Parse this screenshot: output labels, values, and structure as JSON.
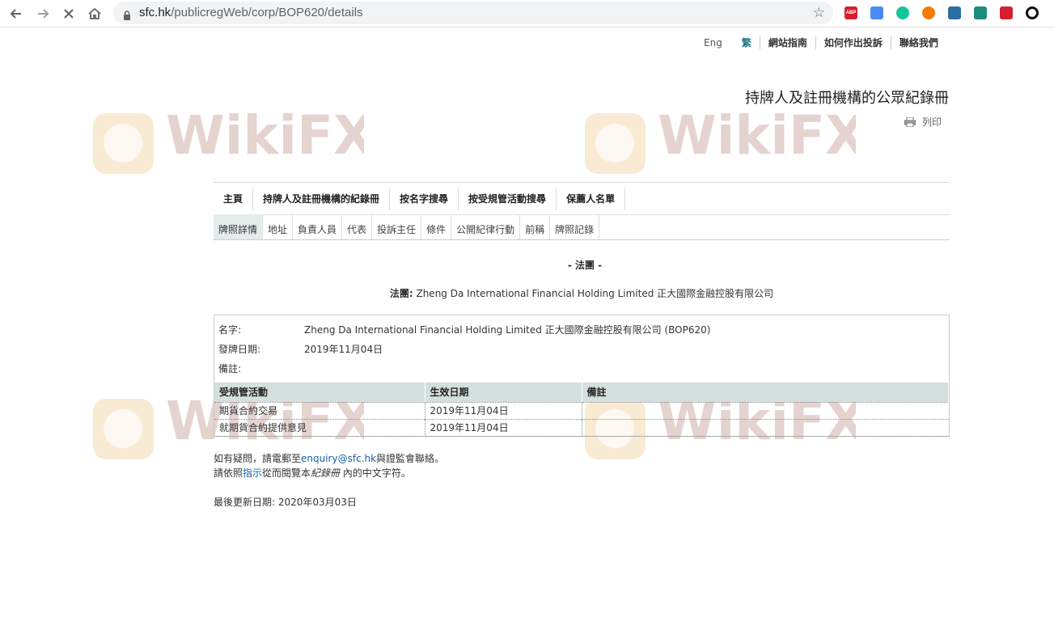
{
  "browser": {
    "url_host": "sfc.hk",
    "url_path": "/publicregWeb/corp/BOP620/details",
    "extensions": [
      {
        "name": "adblock-plus-icon",
        "label": "ABP",
        "color": "#d6202f"
      },
      {
        "name": "translate-icon",
        "label": "",
        "color": "#4a8af4"
      },
      {
        "name": "grammarly-icon",
        "label": "",
        "color": "#15c39a"
      },
      {
        "name": "extension-infinity-icon",
        "label": "",
        "color": "#f57c00"
      },
      {
        "name": "extension-s-icon",
        "label": "",
        "color": "#2e6da4"
      },
      {
        "name": "extension-check-icon",
        "label": "",
        "color": "#1e8c7a"
      },
      {
        "name": "extension-shield-icon",
        "label": "",
        "color": "#d6202f"
      },
      {
        "name": "extension-circle-icon",
        "label": "",
        "color": "#111111"
      }
    ]
  },
  "toplinks": {
    "eng": "Eng",
    "trad": "繁",
    "guide": "網站指南",
    "complaint": "如何作出投訴",
    "contact": "聯絡我們"
  },
  "page_title": "持牌人及註冊機構的公眾紀錄冊",
  "print_label": "列印",
  "main_nav": [
    "主頁",
    "持牌人及註冊機構的紀錄冊",
    "按名字搜尋",
    "按受規管活動搜尋",
    "保薦人名單"
  ],
  "sub_tabs": [
    "牌照詳情",
    "地址",
    "負責人員",
    "代表",
    "投訴主任",
    "條件",
    "公開紀律行動",
    "前稱",
    "牌照記錄"
  ],
  "section_title": "- 法團 -",
  "corp_label": "法團:",
  "corp_name": "Zheng Da International Financial Holding Limited 正大國際金融控股有限公司",
  "details": {
    "name_label": "名字:",
    "name_value": "Zheng Da International Financial Holding Limited 正大國際金融控股有限公司 (BOP620)",
    "issue_label": "發牌日期:",
    "issue_value": "2019年11月04日",
    "remark_label": "備註:",
    "remark_value": ""
  },
  "activities": {
    "headers": [
      "受規管活動",
      "生效日期",
      "備註"
    ],
    "rows": [
      [
        "期貨合約交易",
        "2019年11月04日",
        ""
      ],
      [
        "就期貨合約提供意見",
        "2019年11月04日",
        ""
      ]
    ]
  },
  "footer": {
    "line1_pre": "如有疑問，請電郵至",
    "email": "enquiry@sfc.hk",
    "line1_post": "與證監會聯絡。",
    "line2_pre": "請依照",
    "line2_link": "指示",
    "line2_mid": "從而閱覽本",
    "line2_italic": "紀錄冊",
    "line2_post": " 內的中文字符。",
    "updated": "最後更新日期: 2020年03月03日"
  },
  "watermark_text": "WikiFX"
}
